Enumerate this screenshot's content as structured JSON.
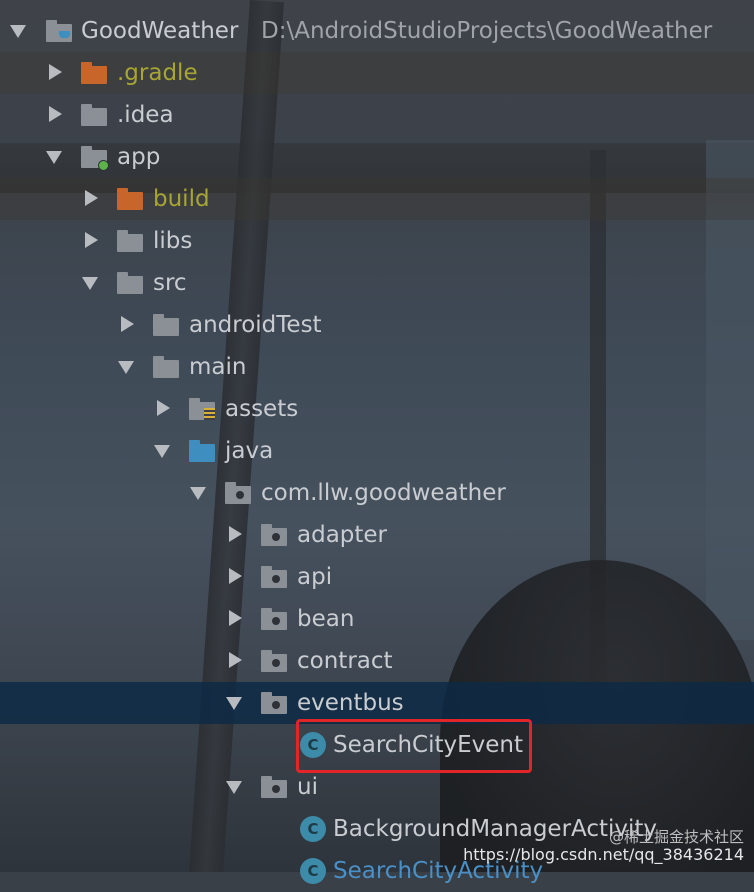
{
  "project": {
    "name": "GoodWeather",
    "path": "D:\\AndroidStudioProjects\\GoodWeather"
  },
  "tree": [
    {
      "label": "GoodWeather",
      "expanded": true,
      "icon": "project-folder-icon"
    },
    {
      "label": ".gradle",
      "expanded": false,
      "icon": "excluded-folder-icon"
    },
    {
      "label": ".idea",
      "expanded": false,
      "icon": "folder-icon"
    },
    {
      "label": "app",
      "expanded": true,
      "icon": "module-folder-icon"
    },
    {
      "label": "build",
      "expanded": false,
      "icon": "excluded-folder-icon"
    },
    {
      "label": "libs",
      "expanded": false,
      "icon": "folder-icon"
    },
    {
      "label": "src",
      "expanded": true,
      "icon": "folder-icon"
    },
    {
      "label": "androidTest",
      "expanded": false,
      "icon": "folder-icon"
    },
    {
      "label": "main",
      "expanded": true,
      "icon": "folder-icon"
    },
    {
      "label": "assets",
      "expanded": false,
      "icon": "resource-folder-icon"
    },
    {
      "label": "java",
      "expanded": true,
      "icon": "source-folder-icon"
    },
    {
      "label": "com.llw.goodweather",
      "expanded": true,
      "icon": "package-icon"
    },
    {
      "label": "adapter",
      "expanded": false,
      "icon": "package-icon"
    },
    {
      "label": "api",
      "expanded": false,
      "icon": "package-icon"
    },
    {
      "label": "bean",
      "expanded": false,
      "icon": "package-icon"
    },
    {
      "label": "contract",
      "expanded": false,
      "icon": "package-icon"
    },
    {
      "label": "eventbus",
      "expanded": true,
      "icon": "package-icon",
      "selected": true
    },
    {
      "label": "SearchCityEvent",
      "icon": "class-icon",
      "highlighted": true
    },
    {
      "label": "ui",
      "expanded": true,
      "icon": "package-icon"
    },
    {
      "label": "BackgroundManagerActivity",
      "icon": "class-icon"
    },
    {
      "label": "SearchCityActivity",
      "icon": "class-icon"
    }
  ],
  "class_icon_letter": "C",
  "watermark": {
    "line1": "@稀土掘金技术社区",
    "line2": "https://blog.csdn.net/qq_38436214"
  },
  "colors": {
    "selection": "#0c2a46",
    "highlight_box": "#e3252a",
    "excluded_text": "#a8a533",
    "class_icon": "#3c8ca9"
  }
}
